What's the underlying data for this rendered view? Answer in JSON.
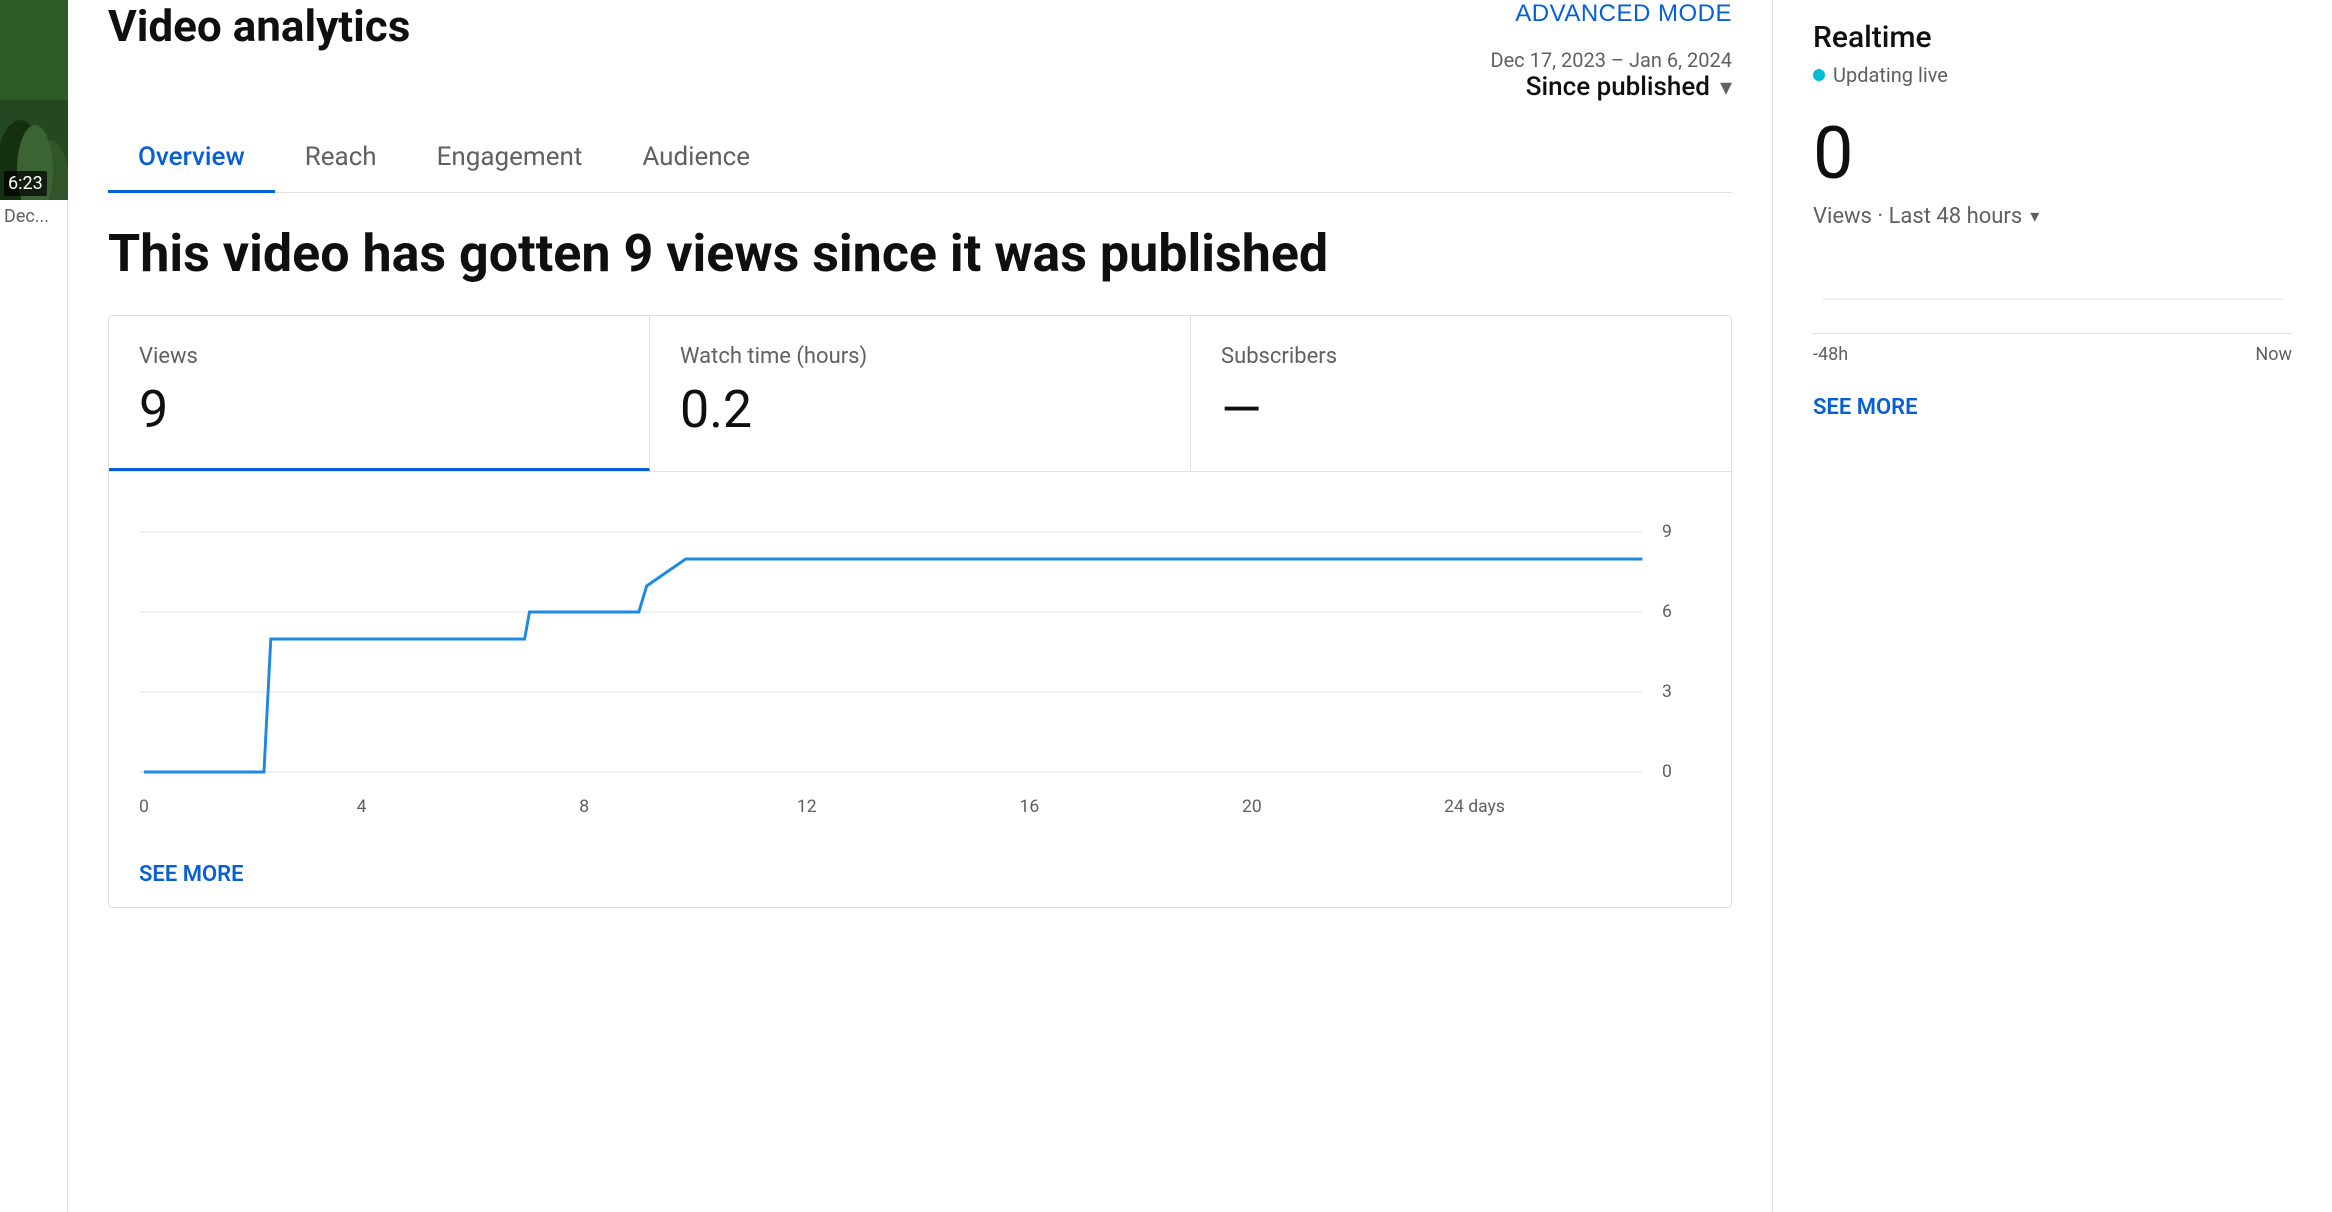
{
  "page": {
    "title": "Video analytics",
    "advanced_mode_label": "ADVANCED MODE"
  },
  "tabs": [
    {
      "id": "overview",
      "label": "Overview",
      "active": true
    },
    {
      "id": "reach",
      "label": "Reach",
      "active": false
    },
    {
      "id": "engagement",
      "label": "Engagement",
      "active": false
    },
    {
      "id": "audience",
      "label": "Audience",
      "active": false
    }
  ],
  "date_range": {
    "range_text": "Dec 17, 2023 – Jan 6, 2024",
    "period_label": "Since published"
  },
  "hero_stat": {
    "text": "This video has gotten 9 views since it was published"
  },
  "metrics": [
    {
      "id": "views",
      "label": "Views",
      "value": "9",
      "active": true
    },
    {
      "id": "watch_time",
      "label": "Watch time (hours)",
      "value": "0.2",
      "active": false
    },
    {
      "id": "subscribers",
      "label": "Subscribers",
      "value": "—",
      "active": false
    }
  ],
  "chart": {
    "x_labels": [
      "0",
      "4",
      "8",
      "12",
      "16",
      "20",
      "24 days"
    ],
    "y_labels": [
      "9",
      "6",
      "3",
      "0"
    ],
    "see_more_label": "SEE MORE"
  },
  "realtime": {
    "title": "Realtime",
    "live_label": "Updating live",
    "count": "0",
    "views_label": "Views · Last 48 hours",
    "time_start": "-48h",
    "time_end": "Now",
    "see_more_label": "SEE MORE"
  },
  "sidebar": {
    "thumbnail_time": "6:23",
    "thumbnail_title": "Dec..."
  }
}
